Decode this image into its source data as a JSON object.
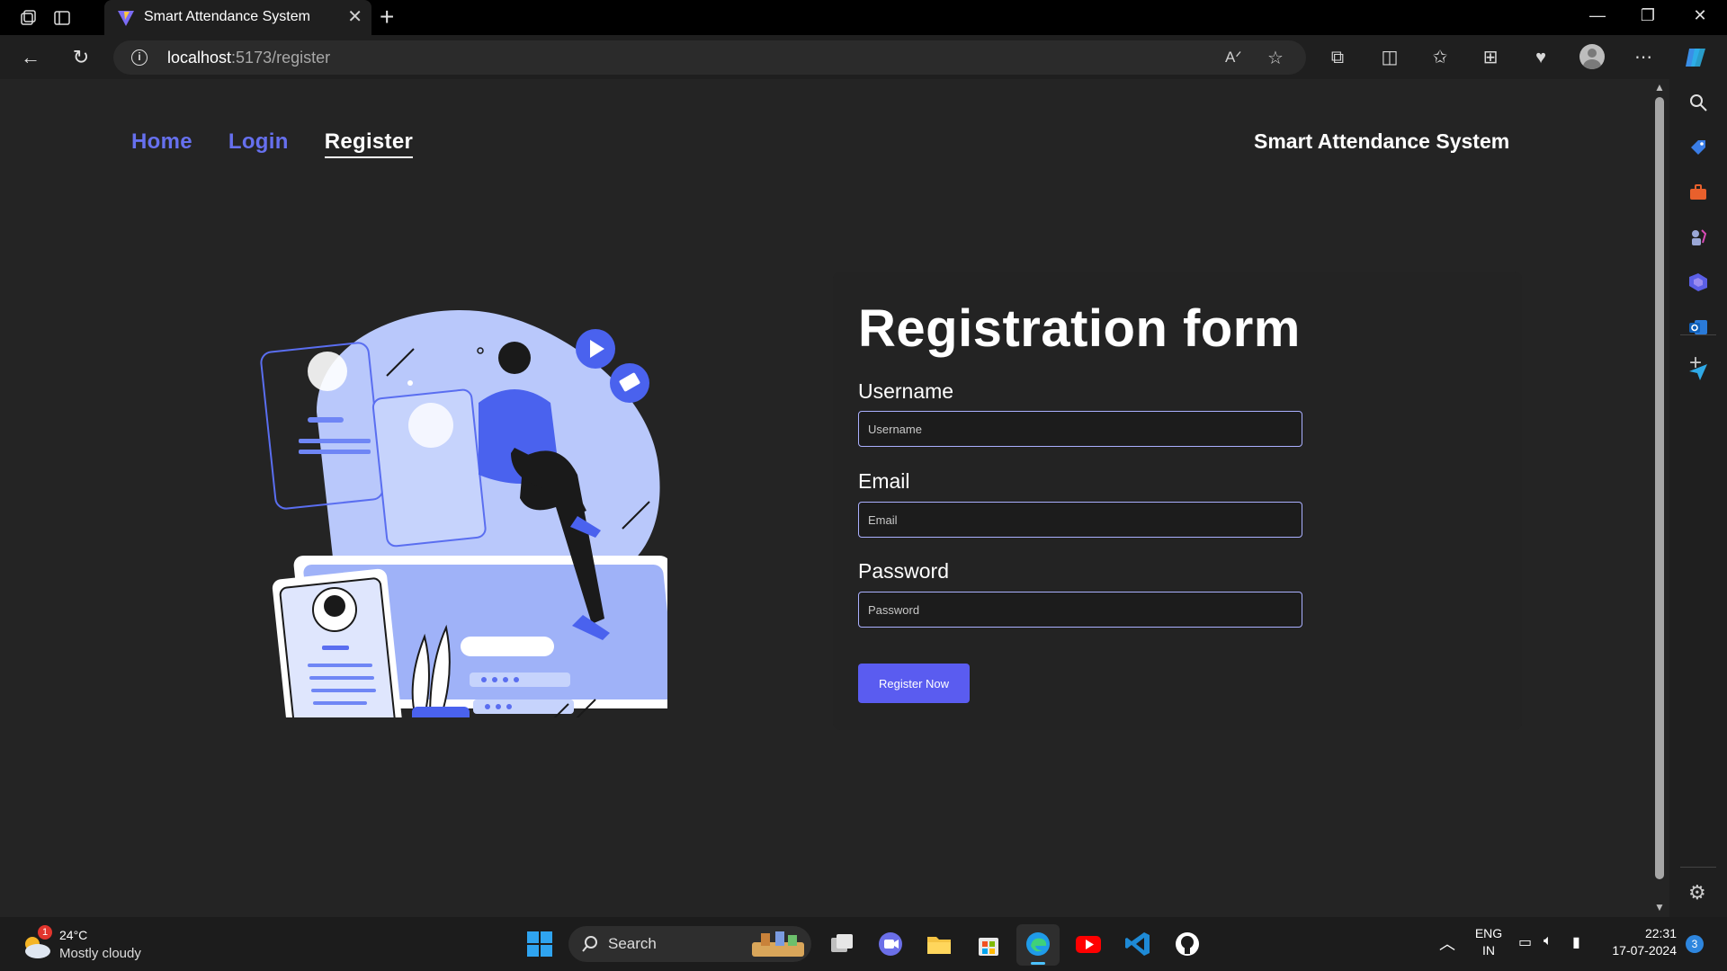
{
  "browser": {
    "tab_title": "Smart Attendance System",
    "url_host": "localhost",
    "url_path": ":5173/register"
  },
  "nav": {
    "home": "Home",
    "login": "Login",
    "register": "Register",
    "brand": "Smart Attendance System"
  },
  "form": {
    "title": "Registration form",
    "username_label": "Username",
    "username_placeholder": "Username",
    "email_label": "Email",
    "email_placeholder": "Email",
    "password_label": "Password",
    "password_placeholder": "Password",
    "submit_label": "Register Now"
  },
  "taskbar": {
    "temp": "24°C",
    "condition": "Mostly cloudy",
    "weather_badge": "1",
    "search_label": "Search",
    "lang_line1": "ENG",
    "lang_line2": "IN",
    "time": "22:31",
    "date": "17-07-2024",
    "notif_count": "3"
  },
  "colors": {
    "accent": "#5a5cf0",
    "nav_link": "#6670ee",
    "page_bg": "#242424"
  }
}
